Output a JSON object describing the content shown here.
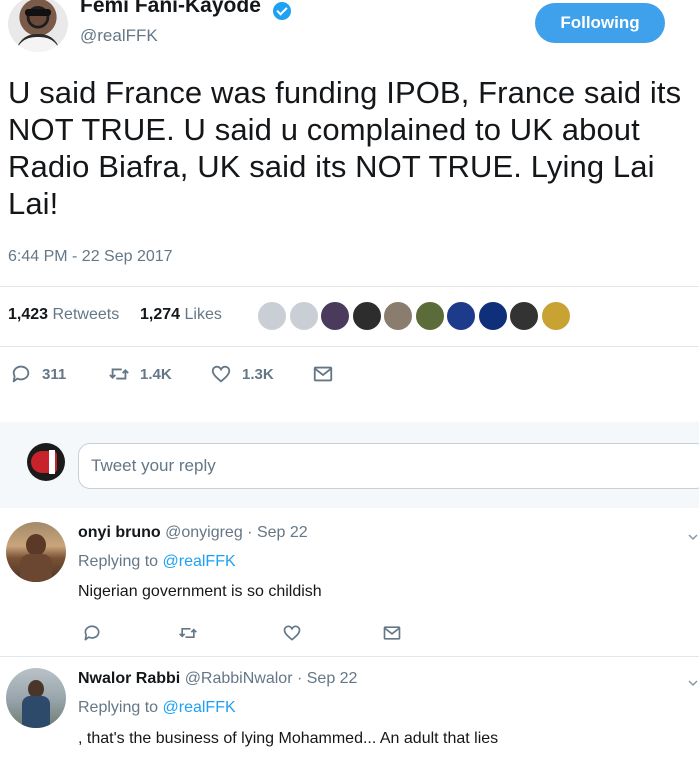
{
  "tweet": {
    "author_name": "Femi Fani-Kayode",
    "author_handle": "@realFFK",
    "follow_label": "Following",
    "text": "U said France was funding IPOB, France said its NOT TRUE. U said u complained to UK about Radio Biafra, UK said its NOT TRUE. Lying Lai Lai!",
    "timestamp": "6:44 PM - 22 Sep 2017",
    "retweets_count": "1,423",
    "retweets_label": "Retweets",
    "likes_count": "1,274",
    "likes_label": "Likes",
    "reply_count": "311",
    "retweet_action_count": "1.4K",
    "like_action_count": "1.3K",
    "liker_colors": [
      "#c9cfd4",
      "#c9cfd4",
      "#4a3b5c",
      "#2d2d2d",
      "#8a7d6e",
      "#5b6b3a",
      "#1e3a8a",
      "#0f2f7a",
      "#333333",
      "#c8a232"
    ]
  },
  "compose": {
    "placeholder": "Tweet your reply"
  },
  "replies": [
    {
      "name": "onyi bruno",
      "meta": "@onyigreg · Sep 22",
      "replying_prefix": "Replying to",
      "mention": "@realFFK",
      "text": "Nigerian government is so childish"
    },
    {
      "name": "Nwalor Rabbi",
      "meta": "@RabbiNwalor · Sep 22",
      "replying_prefix": "Replying to",
      "mention": "@realFFK",
      "text": ", that's the business of lying Mohammed... An adult that lies"
    }
  ],
  "colors": {
    "accent": "#1da1f2",
    "follow_button": "#3fa0ec",
    "muted": "#657786",
    "text": "#14171a"
  }
}
